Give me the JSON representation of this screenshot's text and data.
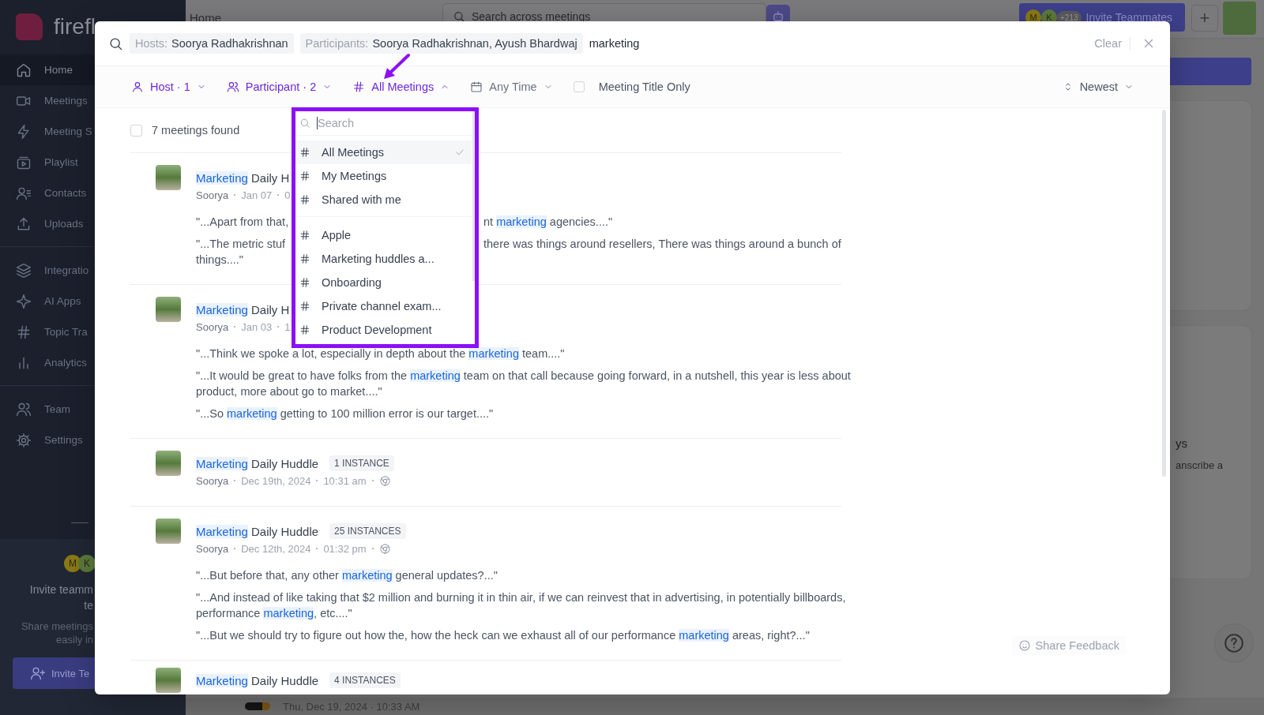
{
  "sidebar": {
    "logo": "firefl",
    "groups": [
      [
        {
          "label": "Home",
          "selected": true
        },
        {
          "label": "Meetings",
          "selected": false
        },
        {
          "label": "Meeting S",
          "selected": false
        },
        {
          "label": "Playlist",
          "selected": false
        },
        {
          "label": "Contacts",
          "selected": false
        },
        {
          "label": "Uploads",
          "selected": false
        }
      ],
      [
        {
          "label": "Integratio",
          "selected": false
        },
        {
          "label": "AI Apps",
          "selected": false
        },
        {
          "label": "Topic Tra",
          "selected": false
        },
        {
          "label": "Analytics",
          "selected": false
        }
      ],
      [
        {
          "label": "Team",
          "selected": false
        },
        {
          "label": "Settings",
          "selected": false
        }
      ]
    ],
    "invite": {
      "avatars": [
        "M",
        "K"
      ],
      "title_lines": [
        "Invite teamm",
        "te"
      ],
      "text_lines": [
        "Share meetings",
        "easily in"
      ],
      "button": "Invite Te"
    }
  },
  "header": {
    "title": "Home",
    "search": {
      "placeholder": "Search across meetings"
    },
    "invite": {
      "avatars": [
        "M",
        "K"
      ],
      "count": "+213",
      "label": "Invite Teammates"
    },
    "add_button": "+"
  },
  "background_panel": {
    "heading": "ys",
    "text": "anscribe a"
  },
  "bottom_bar": {
    "timestamp": "Thu, Dec 19, 2024 · 10:33 AM"
  },
  "search_modal": {
    "chips": [
      {
        "label": "Hosts:",
        "value": "Soorya Radhakrishnan"
      },
      {
        "label": "Participants:",
        "value": "Soorya Radhakrishnan, Ayush Bhardwaj"
      }
    ],
    "query": "marketing",
    "clear": "Clear",
    "filters": [
      {
        "label": "Host · 1",
        "active": true,
        "open": false
      },
      {
        "label": "Participant · 2",
        "active": true,
        "open": false
      },
      {
        "label": "All Meetings",
        "active": true,
        "open": true
      },
      {
        "label": "Any Time",
        "active": false,
        "open": false
      }
    ],
    "title_only": {
      "label": "Meeting Title Only",
      "checked": false
    },
    "sort": {
      "label": "Newest"
    },
    "results_count": {
      "label": "7 meetings found",
      "checked": false
    },
    "dropdown": {
      "search": {
        "placeholder": "Search"
      },
      "groups": [
        [
          {
            "label": "All Meetings",
            "selected": true
          },
          {
            "label": "My Meetings",
            "selected": false
          },
          {
            "label": "Shared with me",
            "selected": false
          }
        ],
        [
          {
            "label": "Apple",
            "selected": false
          },
          {
            "label": "Marketing huddles a...",
            "selected": false
          },
          {
            "label": "Onboarding",
            "selected": false
          },
          {
            "label": "Private channel exam...",
            "selected": false
          },
          {
            "label": "Product Development",
            "selected": false
          }
        ]
      ]
    },
    "results": [
      {
        "title": "**Marketing** Daily H",
        "meta": [
          "Soorya",
          "Jan 07",
          "0"
        ],
        "snippets": [
          {
            "lines": [
              {
                "left": "\"...Apart from that,",
                "right": "nt **marketing** agencies....\""
              }
            ]
          },
          {
            "lines": [
              {
                "left": "\"...The metric stuf",
                "right": "there was things around resellers, There was things around a bunch of"
              },
              {
                "left": "things....\""
              }
            ]
          }
        ]
      },
      {
        "title": "**Marketing** Daily H",
        "meta": [
          "Soorya",
          "Jan 03",
          "1"
        ],
        "snippets": [
          {
            "lines": [
              {
                "left": "\"...Think we spoke a lot, especially in depth about the **marketing** team....\""
              }
            ]
          },
          {
            "lines": [
              {
                "left": "\"...It would be great to have folks from the **marketing** team on that call because going forward, in a nutshell, this year is less about"
              },
              {
                "left": "product, more about go to market....\""
              }
            ]
          },
          {
            "lines": [
              {
                "left": "\"...So **marketing** getting to 100 million error is our target....\""
              }
            ]
          }
        ]
      },
      {
        "title": "**Marketing** Daily Huddle",
        "badge": "1 INSTANCE",
        "meta": [
          "Soorya",
          "Dec 19th, 2024",
          "10:31 am"
        ],
        "source_icon": true
      },
      {
        "title": "**Marketing** Daily Huddle",
        "badge": "25 INSTANCES",
        "meta": [
          "Soorya",
          "Dec 12th, 2024",
          "01:32 pm"
        ],
        "source_icon": true,
        "snippets": [
          {
            "lines": [
              {
                "left": "\"...But before that, any other **marketing** general updates?...\""
              }
            ]
          },
          {
            "lines": [
              {
                "left": "\"...And instead of like taking that $2 million and burning it in thin air, if we can reinvest that in advertising, in potentially billboards,"
              },
              {
                "left": "performance **marketing**, etc....\""
              }
            ]
          },
          {
            "lines": [
              {
                "left": "\"...But we should try to figure out how the, how the heck can we exhaust all of our performance **marketing** areas, right?...\""
              }
            ]
          }
        ]
      },
      {
        "title": "**Marketing** Daily Huddle",
        "badge": "4 INSTANCES"
      }
    ],
    "feedback": "Share Feedback"
  }
}
